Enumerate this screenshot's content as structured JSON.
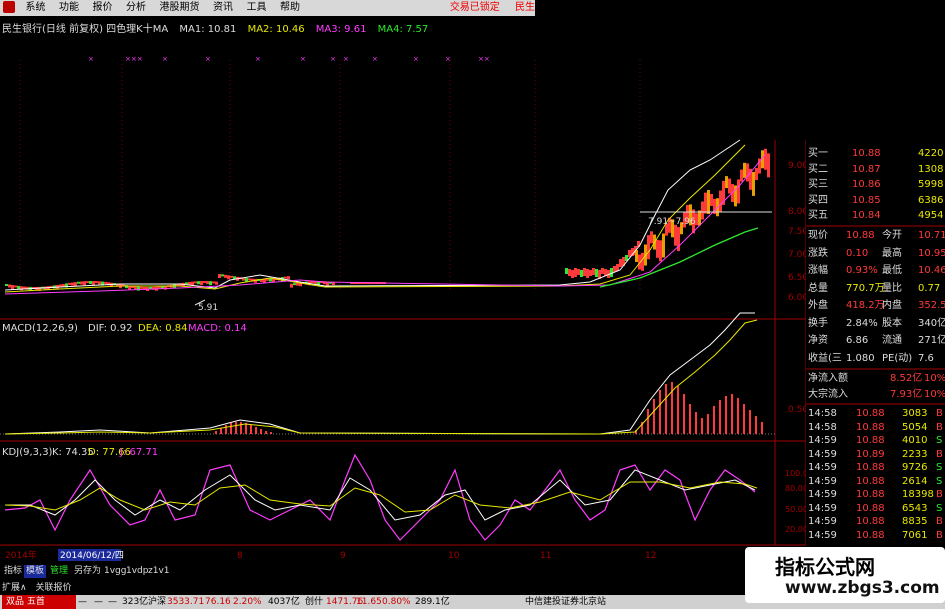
{
  "menu": {
    "items": [
      "系统",
      "功能",
      "报价",
      "分析",
      "港股期货",
      "资讯",
      "工具",
      "帮助"
    ],
    "right": [
      "交易已锁定",
      "民生"
    ]
  },
  "chart_header": {
    "title": "民生银行(日线 前复权) 四色理K十MA",
    "ma1": "MA1: 10.81",
    "ma2": "MA2: 10.46",
    "ma3": "MA3: 9.61",
    "ma4": "MA4: 7.57"
  },
  "price_axis": [
    "9.00",
    "8.00",
    "7.50",
    "7.00",
    "6.50",
    "6.00"
  ],
  "price_annotations": {
    "low": "5.91",
    "mid": "7.91~7.96"
  },
  "macd": {
    "label": "MACD(12,26,9)",
    "dif": "DIF: 0.92",
    "dea": "DEA: 0.84",
    "macd": "MACD: 0.14",
    "axis": "0.50"
  },
  "kdj": {
    "label": "KDJ(9,3,3)",
    "k": "K: 74.35",
    "d": "D: 77.66",
    "j": "J: 67.71",
    "axis": [
      "100.00",
      "80.00",
      "50.00",
      "20.00"
    ]
  },
  "time_axis": {
    "year": "2014年",
    "cursor": "2014/06/12/四",
    "ticks": [
      "8",
      "9",
      "10",
      "11",
      "12"
    ]
  },
  "quote": {
    "bids": [
      {
        "label": "买一",
        "price": "10.88",
        "vol": "4220"
      },
      {
        "label": "买二",
        "price": "10.87",
        "vol": "1308"
      },
      {
        "label": "买三",
        "price": "10.86",
        "vol": "5998"
      },
      {
        "label": "买四",
        "price": "10.85",
        "vol": "6386"
      },
      {
        "label": "买五",
        "price": "10.84",
        "vol": "4954"
      }
    ],
    "stats": [
      {
        "l1": "现价",
        "v1": "10.88",
        "l2": "今开",
        "v2": "10.71"
      },
      {
        "l1": "涨跌",
        "v1": "0.10",
        "l2": "最高",
        "v2": "10.95"
      },
      {
        "l1": "涨幅",
        "v1": "0.93%",
        "l2": "最低",
        "v2": "10.46"
      },
      {
        "l1": "总量",
        "v1": "770.7万",
        "l2": "量比",
        "v2": "0.77"
      },
      {
        "l1": "外盘",
        "v1": "418.2万",
        "l2": "内盘",
        "v2": "352.5万"
      },
      {
        "l1": "换手",
        "v1": "2.84%",
        "l2": "股本",
        "v2": "340亿"
      },
      {
        "l1": "净资",
        "v1": "6.86",
        "l2": "流通",
        "v2": "271亿"
      },
      {
        "l1": "收益(三",
        "v1": "1.080",
        "l2": "PE(动)",
        "v2": "7.6"
      }
    ],
    "flows": [
      {
        "label": "净流入额",
        "value": "8.52亿",
        "pct": "10%"
      },
      {
        "label": "大宗流入",
        "value": "7.93亿",
        "pct": "10%"
      }
    ],
    "ticks": [
      {
        "time": "14:58",
        "price": "10.88",
        "vol": "3083",
        "side": "B"
      },
      {
        "time": "14:58",
        "price": "10.88",
        "vol": "5054",
        "side": "B"
      },
      {
        "time": "14:59",
        "price": "10.88",
        "vol": "4010",
        "side": "S"
      },
      {
        "time": "14:59",
        "price": "10.89",
        "vol": "2233",
        "side": "B"
      },
      {
        "time": "14:59",
        "price": "10.88",
        "vol": "9726",
        "side": "S"
      },
      {
        "time": "14:59",
        "price": "10.88",
        "vol": "2614",
        "side": "S"
      },
      {
        "time": "14:59",
        "price": "10.88",
        "vol": "18398",
        "side": "B"
      },
      {
        "time": "14:59",
        "price": "10.88",
        "vol": "6543",
        "side": "S"
      },
      {
        "time": "14:59",
        "price": "10.88",
        "vol": "8835",
        "side": "B"
      },
      {
        "time": "14:59",
        "price": "10.88",
        "vol": "7061",
        "side": "B"
      }
    ]
  },
  "bottom_tabs": [
    "指标",
    "模板",
    "管理",
    "另存为",
    "1vgg",
    "1vdp",
    "z1v1"
  ],
  "bottom_tabs2": [
    "扩展∧",
    "关联报价"
  ],
  "status": {
    "logo_text": "双品 五首",
    "t1": "323亿",
    "sh_label": "沪深",
    "sh_val": "3533.71",
    "sh_chg": "76.16",
    "sh_pct": "2.20%",
    "sh_amt": "4037亿",
    "cy_label": "创什",
    "cy_val": "1471.76",
    "cy_chg": "11.65",
    "cy_pct": "0.80%",
    "cy_amt": "289.1亿",
    "broker": "中信建投证券北京站"
  },
  "watermark": {
    "line1": "指标公式网",
    "line2": "www.zbgs3.com"
  },
  "colors": {
    "up": "#ff3a3a",
    "down": "#2ee82e",
    "ma1": "#ffffff",
    "ma2": "#e8e800",
    "ma3": "#ff3cff",
    "ma4": "#2ee82e"
  }
}
